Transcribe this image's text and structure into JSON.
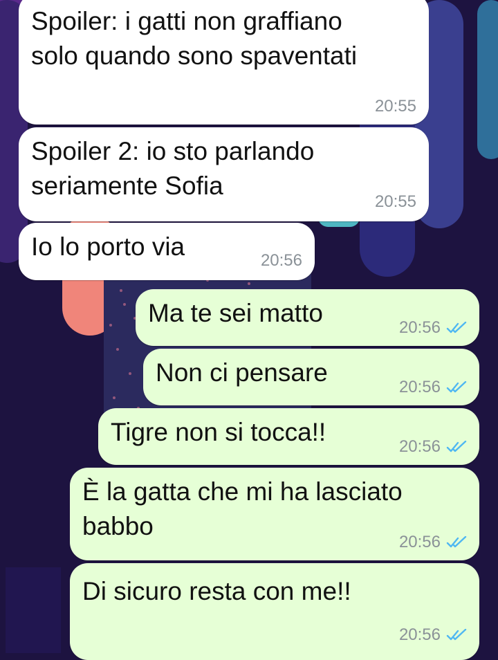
{
  "colors": {
    "background": "#1d1340",
    "incoming_bubble": "#ffffff",
    "outgoing_bubble": "#e6ffd6",
    "read_ticks": "#4fb7f2",
    "timestamp": "#8a9197"
  },
  "messages": [
    {
      "direction": "incoming",
      "text": "Spoiler: i gatti non graffiano\nsolo quando sono spaventati",
      "time": "20:55"
    },
    {
      "direction": "incoming",
      "text": "Spoiler 2: io sto parlando\nseriamente Sofia",
      "time": "20:55"
    },
    {
      "direction": "incoming",
      "text": "Io lo porto via",
      "time": "20:56"
    },
    {
      "direction": "outgoing",
      "text": "Ma te sei matto",
      "time": "20:56",
      "status_icon": "double-check-read-icon"
    },
    {
      "direction": "outgoing",
      "text": "Non ci pensare",
      "time": "20:56",
      "status_icon": "double-check-read-icon"
    },
    {
      "direction": "outgoing",
      "text": "Tigre non si tocca!!",
      "time": "20:56",
      "status_icon": "double-check-read-icon"
    },
    {
      "direction": "outgoing",
      "text": "È la gatta che mi ha lasciato\nbabbo",
      "time": "20:56",
      "status_icon": "double-check-read-icon"
    },
    {
      "direction": "outgoing",
      "text": "Di sicuro resta con me!!",
      "time": "20:56",
      "status_icon": "double-check-read-icon"
    }
  ]
}
